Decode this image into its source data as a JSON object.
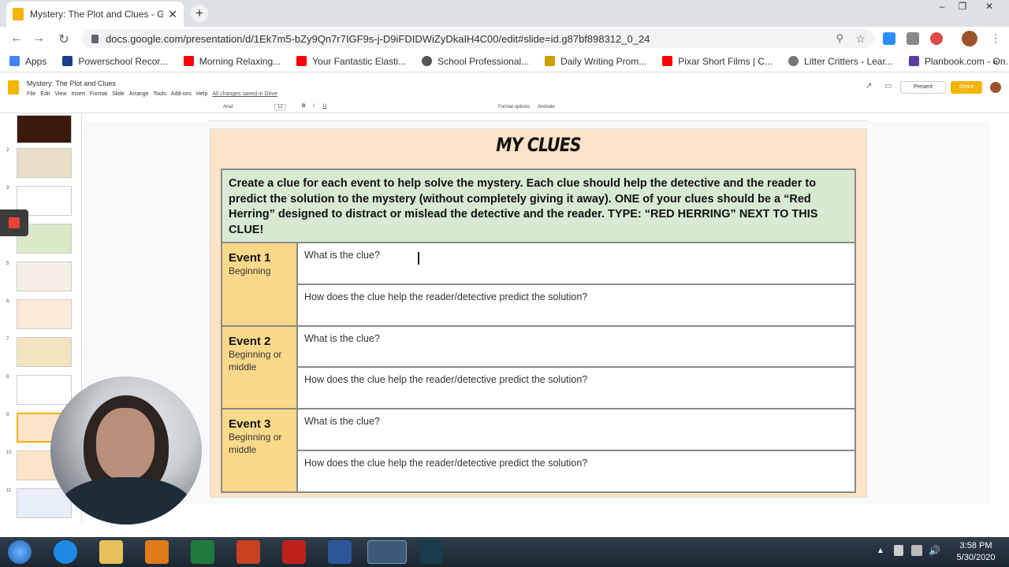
{
  "browser": {
    "tab_title": "Mystery: The Plot and Clues - Go",
    "url": "docs.google.com/presentation/d/1Ek7m5-bZy9Qn7r7IGF9s-j-D9iFDIDWiZyDkaIH4C00/edit#slide=id.g87bf898312_0_24"
  },
  "bookmarks": [
    {
      "label": "Apps",
      "color": "#4285f4"
    },
    {
      "label": "Powerschool Recor...",
      "color": "#1a3f8a"
    },
    {
      "label": "Morning Relaxing...",
      "color": "#ff0000"
    },
    {
      "label": "Your Fantastic Elasti...",
      "color": "#ff0000"
    },
    {
      "label": "School Professional...",
      "color": "#555555"
    },
    {
      "label": "Daily Writing Prom...",
      "color": "#c8a000"
    },
    {
      "label": "Pixar Short Films | C...",
      "color": "#ff0000"
    },
    {
      "label": "Litter Critters - Lear...",
      "color": "#777777"
    },
    {
      "label": "Planbook.com - On...",
      "color": "#5a3fa0"
    }
  ],
  "slides_app": {
    "doc_title": "Mystery: The Plot and Clues",
    "menus": [
      "File",
      "Edit",
      "View",
      "Insert",
      "Format",
      "Slide",
      "Arrange",
      "Tools",
      "Add-ons",
      "Help"
    ],
    "save_status": "All changes saved in Drive",
    "present_label": "Present",
    "share_label": "Share",
    "font_name": "Arial",
    "font_size": "12",
    "format_options": "Format options",
    "animate": "Animate"
  },
  "filmstrip_numbers": [
    "2",
    "3",
    "4",
    "5",
    "6",
    "7",
    "8",
    "9",
    "10",
    "11"
  ],
  "slide": {
    "title": "MY CLUES",
    "instructions": "Create a clue for each event to help solve the mystery. Each clue should help the detective and the reader to predict the solution to the mystery (without completely giving it away). ONE of your clues should be a “Red Herring” designed to distract or mislead the detective and the reader. TYPE: “RED HERRING” NEXT TO THIS CLUE!",
    "events": [
      {
        "name": "Event 1",
        "sub": "Beginning",
        "q1": "What is the clue?",
        "q2": "How does the clue help the reader/detective predict the solution?"
      },
      {
        "name": "Event 2",
        "sub": "Beginning or middle",
        "q1": "What is the clue?",
        "q2": "How does the clue help the reader/detective predict the solution?"
      },
      {
        "name": "Event 3",
        "sub": "Beginning or middle",
        "q1": "What is the clue?",
        "q2": "How does the clue help the reader/detective predict the solution?"
      }
    ]
  },
  "taskbar": {
    "time": "3:58 PM",
    "date": "5/30/2020"
  },
  "colors": {
    "instruction_bg": "#d9ead3",
    "event_bg": "#fbd98a",
    "slide_bg": "#fde3c8",
    "share_btn": "#f4b400"
  }
}
